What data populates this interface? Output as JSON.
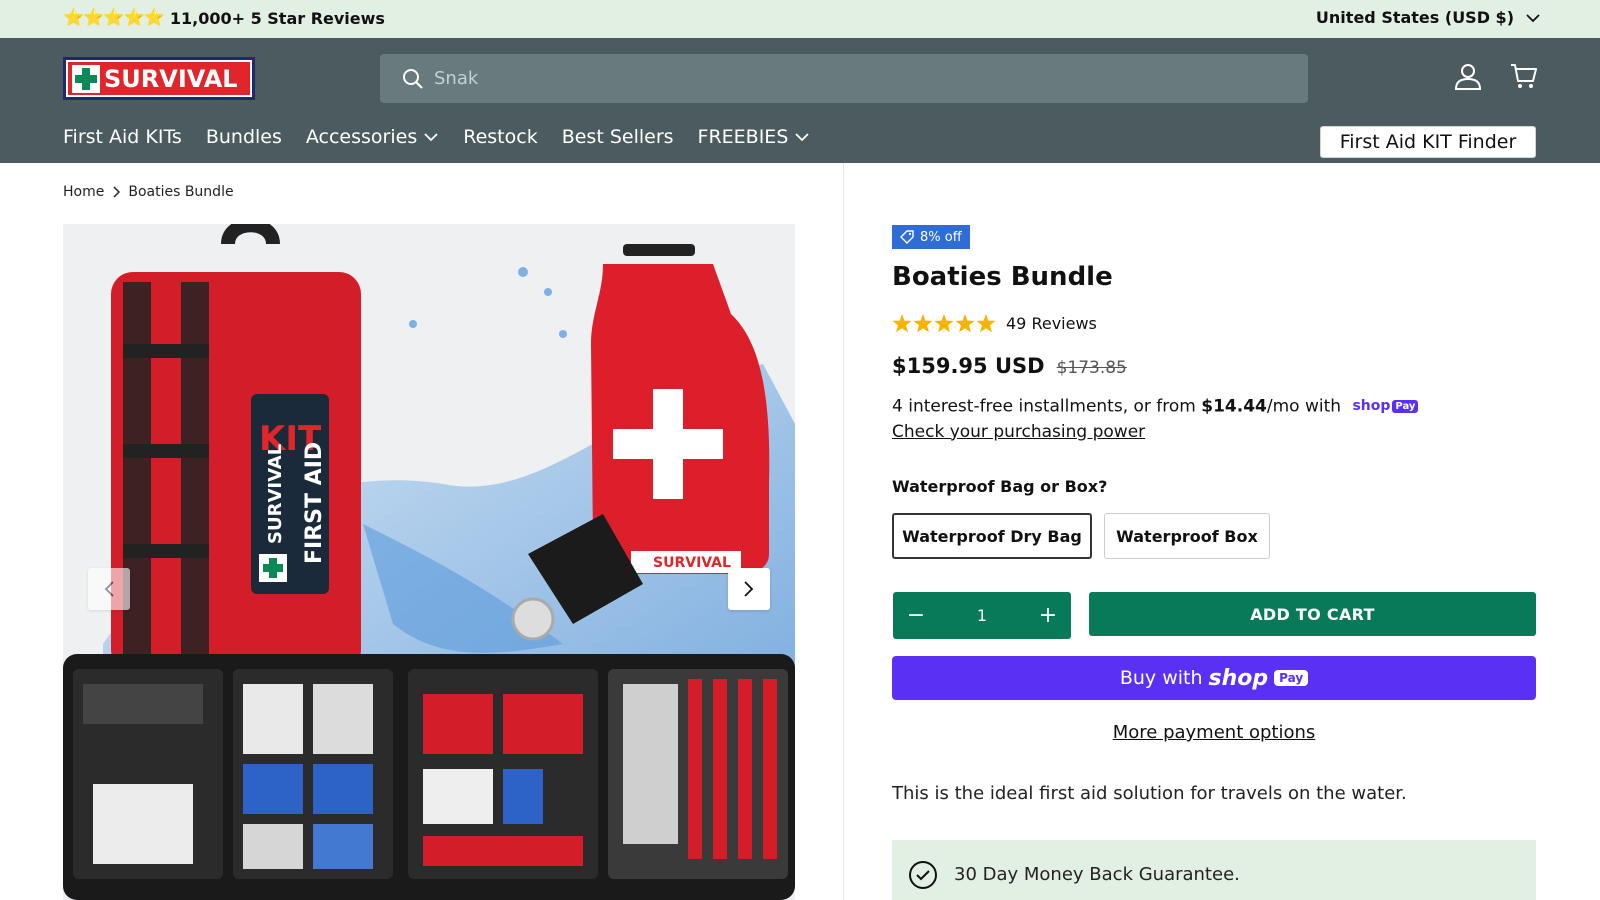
{
  "announcement": {
    "stars": "⭐⭐⭐⭐⭐",
    "reviews_text": "11,000+ 5 Star Reviews",
    "currency": "United States (USD $)"
  },
  "header": {
    "logo_text": "SURVIVAL",
    "search_placeholder": "Snak",
    "nav": [
      {
        "label": "First Aid KITs"
      },
      {
        "label": "Bundles"
      },
      {
        "label": "Accessories"
      },
      {
        "label": "Restock"
      },
      {
        "label": "Best Sellers"
      },
      {
        "label": "FREEBIES"
      }
    ],
    "kit_finder": "First Aid KIT Finder"
  },
  "breadcrumb": {
    "home": "Home",
    "current": "Boaties Bundle"
  },
  "product": {
    "badge": "8% off",
    "title": "Boaties Bundle",
    "reviews": "49 Reviews",
    "rating": 5,
    "price": "$159.95 USD",
    "compare_price": "$173.85",
    "installments_prefix": "4 interest-free installments, or from ",
    "installments_amount": "$14.44",
    "installments_suffix": "/mo with",
    "shoppay_mini_shop": "shop",
    "shoppay_mini_pay": "Pay",
    "check_power": "Check your purchasing power",
    "option_label": "Waterproof Bag or Box?",
    "options": [
      "Waterproof Dry Bag",
      "Waterproof Box"
    ],
    "selected_option": "Waterproof Dry Bag",
    "quantity": "1",
    "add_to_cart": "ADD TO CART",
    "buy_with": "Buy with",
    "shop": "shop",
    "pay": "Pay",
    "more_payment": "More payment options",
    "description": "This is the ideal first aid solution for travels on the water.",
    "guarantee": "30 Day Money Back Guarantee."
  },
  "gallery": {
    "kit_text_1": "KIT",
    "kit_text_2": "SURVIVAL",
    "kit_text_3": "FIRST AID",
    "bag_label": "SURVIVAL"
  },
  "colors": {
    "announcement_bg": "#e2efe3",
    "header_bg": "#4b5b60",
    "accent_green": "#087a5a",
    "shoppay_purple": "#5a31f4",
    "badge_blue": "#2f6cd3",
    "star_yellow": "#f5b400"
  },
  "icons": [
    "search-icon",
    "account-icon",
    "cart-icon",
    "chevron-down-icon",
    "chevron-right-icon",
    "tag-icon",
    "star-icon",
    "check-circle-icon"
  ]
}
